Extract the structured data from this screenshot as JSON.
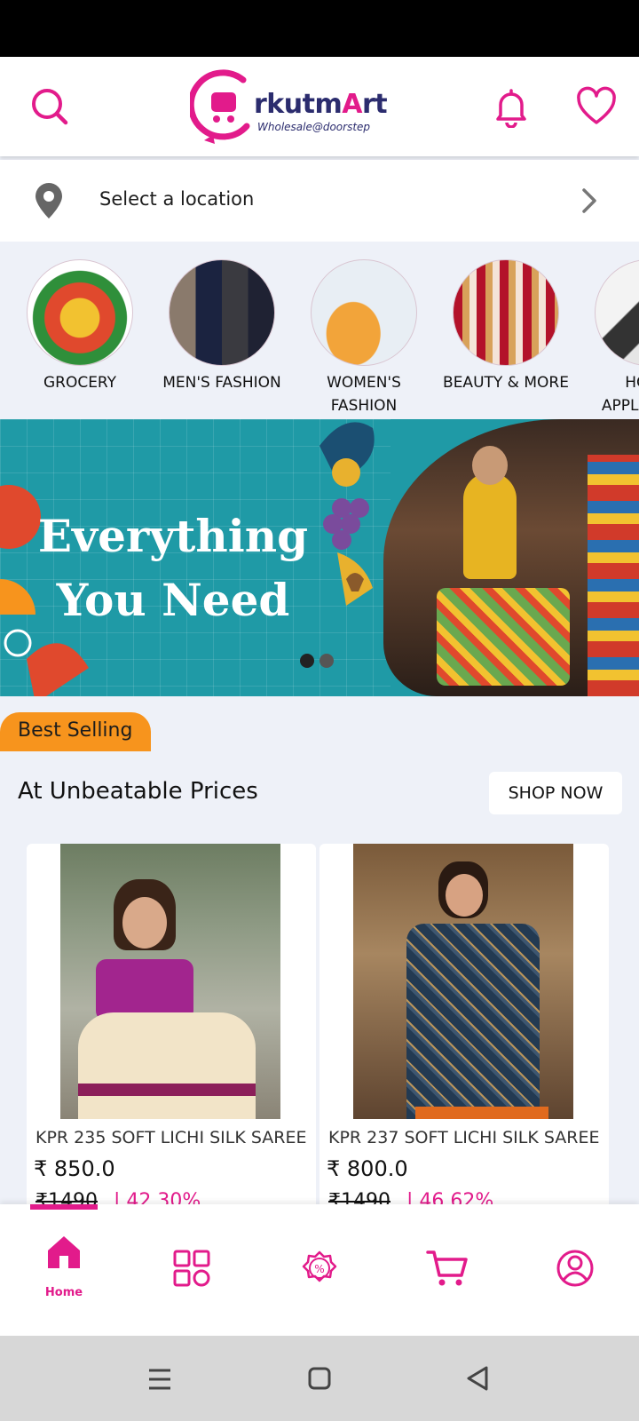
{
  "header": {
    "logo_main": "rkutm",
    "logo_accent": "A",
    "logo_end": "rt",
    "logo_tagline": "Wholesale@doorstep",
    "icons": [
      "search-icon",
      "bell-icon",
      "heart-icon"
    ]
  },
  "location": {
    "label": "Select a location"
  },
  "categories": [
    {
      "label": "GROCERY"
    },
    {
      "label": "MEN'S FASHION"
    },
    {
      "label": "WOMEN'S FASHION"
    },
    {
      "label": "BEAUTY & MORE"
    },
    {
      "label": "HOME APPLIANCES"
    }
  ],
  "banner": {
    "line1": "Everything",
    "line2": "You Need",
    "slides": 2,
    "active_slide": 1
  },
  "section": {
    "tab": "Best Selling",
    "title": "At Unbeatable Prices",
    "shop_now": "SHOP NOW"
  },
  "products": [
    {
      "name": "KPR 235 SOFT LICHI SILK SAREE",
      "price": "₹ 850.0",
      "mrp": "₹1490",
      "off": "| 42.30%"
    },
    {
      "name": "KPR 237 SOFT LICHI SILK SAREE",
      "price": "₹ 800.0",
      "mrp": "₹1490",
      "off": "| 46.62%"
    }
  ],
  "nav": {
    "home_label": "Home",
    "items": [
      "home-icon",
      "categories-icon",
      "offers-icon",
      "cart-icon",
      "profile-icon"
    ]
  },
  "colors": {
    "brand": "#e21b8b",
    "brand_dark": "#2b2c6e",
    "accent_orange": "#f7941d",
    "banner_teal": "#1f9aa6"
  }
}
